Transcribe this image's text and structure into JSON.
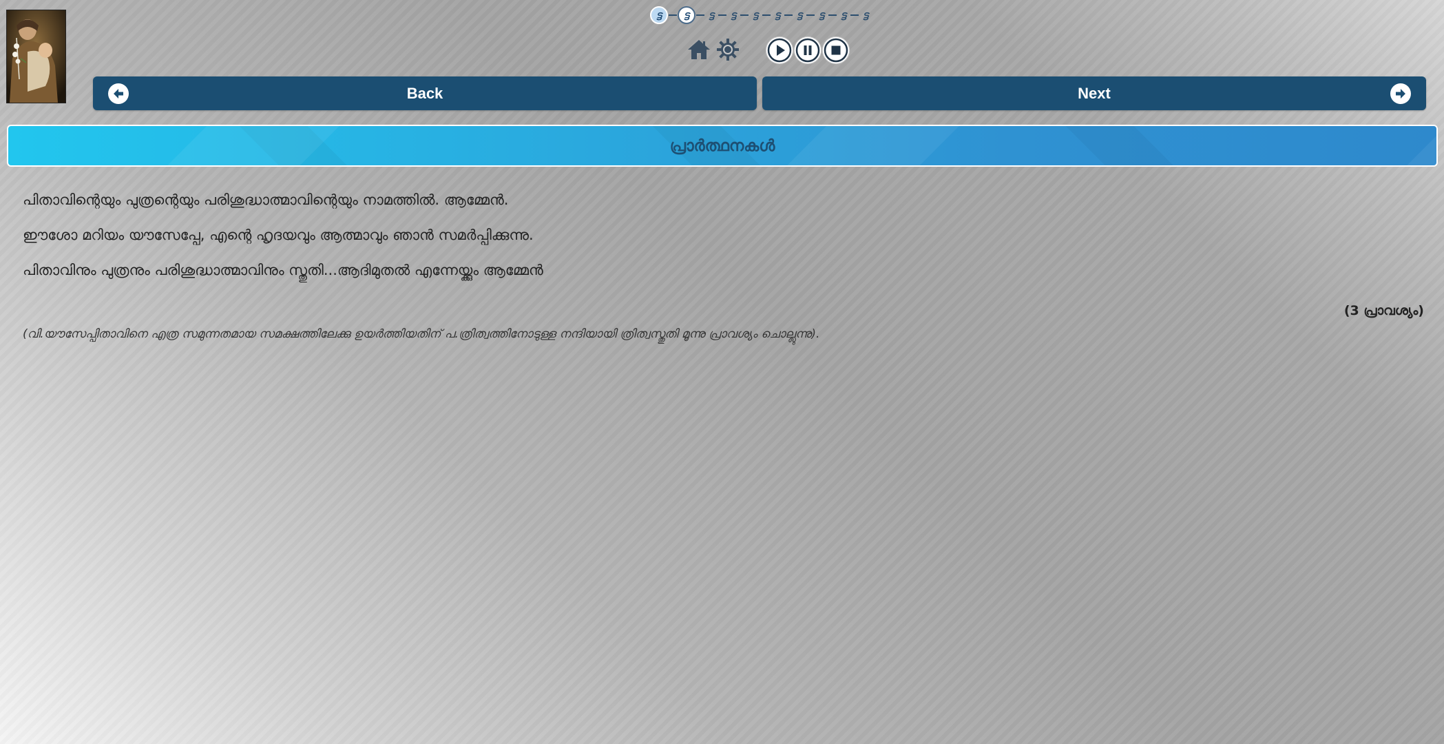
{
  "progress": {
    "steps": [
      "ട്ട",
      "ട്ട",
      "ട്ട",
      "ട്ട",
      "ട്ട",
      "ട്ട",
      "ട്ട",
      "ട്ട",
      "ട്ട",
      "ട്ട"
    ],
    "current_index": 1
  },
  "navigation": {
    "back_label": "Back",
    "next_label": "Next"
  },
  "toolbar": {
    "icons": [
      "home-icon",
      "settings-icon",
      "play-icon",
      "pause-icon",
      "stop-icon"
    ]
  },
  "title": "പ്രാർത്ഥനകൾ",
  "prayer": {
    "lines": [
      "പിതാവിന്റെയും പുത്രന്റെയും പരിശുദ്ധാത്മാവിന്റെയും നാമത്തിൽ. ആമ്മേൻ.",
      "ഈശോ മറിയം യൗസേപ്പേ,  എന്റെ ഹൃദയവും ആത്മാവും ഞാൻ സമർപ്പിക്കുന്നു.",
      "പിതാവിനും പുത്രനും പരിശുദ്ധാത്മാവിനും സ്തുതി...ആദിമുതൽ എന്നേയ്ക്കും ആമ്മേൻ"
    ],
    "repeat_note": "(3 പ്രാവശ്യം)",
    "italic_note": "(വി.യൗസേപ്പിതാവിനെ എത്ര സമുന്നതമായ സമക്ഷത്തിലേക്കു ഉയർത്തിയതിന് പ.ത്രിത്വത്തിനോടുള്ള നന്ദിയായി ത്രിത്വസ്തുതി മൂന്നു പ്രാവശ്യം ചൊല്ലുന്നു)."
  },
  "colors": {
    "nav_button": "#1b4e72",
    "title_bar": "#22c6ee",
    "title_text": "#1d4f73"
  }
}
